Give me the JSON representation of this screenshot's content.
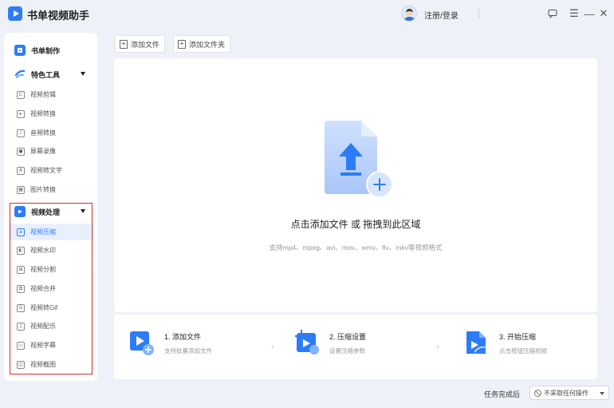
{
  "app": {
    "title": "书单视频助手",
    "login": "注册/登录"
  },
  "window": {
    "feedback_icon": "chat-icon",
    "menu": "☰",
    "minimize": "—",
    "close": "✕"
  },
  "sidebar": {
    "main1": {
      "label": "书单制作",
      "icon": "book-icon"
    },
    "main2": {
      "label": "特色工具",
      "icon": "wand-icon"
    },
    "tools": [
      {
        "label": "视频剪辑",
        "icon": "crop-icon",
        "glyph": "⊏"
      },
      {
        "label": "视频转换",
        "icon": "video-convert-icon",
        "glyph": "▸"
      },
      {
        "label": "音频转换",
        "icon": "audio-icon",
        "glyph": "♪"
      },
      {
        "label": "屏幕录像",
        "icon": "record-icon",
        "glyph": "●"
      },
      {
        "label": "视频转文字",
        "icon": "text-icon",
        "glyph": "A"
      },
      {
        "label": "图片转换",
        "icon": "image-icon",
        "glyph": "▦"
      }
    ],
    "main3": {
      "label": "视频处理",
      "icon": "video-process-icon"
    },
    "processing": [
      {
        "label": "视频压缩",
        "icon": "compress-icon",
        "glyph": "≡"
      },
      {
        "label": "视频水印",
        "icon": "watermark-icon",
        "glyph": "◐"
      },
      {
        "label": "视频分割",
        "icon": "split-icon",
        "glyph": "⊞"
      },
      {
        "label": "视频合并",
        "icon": "merge-icon",
        "glyph": "⧉"
      },
      {
        "label": "视频转Gif",
        "icon": "gif-icon",
        "glyph": "G"
      },
      {
        "label": "视频配乐",
        "icon": "music-icon",
        "glyph": "♫"
      },
      {
        "label": "视频字幕",
        "icon": "subtitle-icon",
        "glyph": "▭"
      },
      {
        "label": "视频截图",
        "icon": "screenshot-icon",
        "glyph": "◫"
      }
    ],
    "active": "视频压缩"
  },
  "toolbar": {
    "add_file": "添加文件",
    "add_folder": "添加文件夹"
  },
  "dropzone": {
    "title": "点击添加文件 或 拖拽到此区域",
    "hint": "支持mp4、mpeg、avi、mov、wmv、flv、mkv等视频格式"
  },
  "steps": [
    {
      "title": "1. 添加文件",
      "desc": "支持批量添加文件"
    },
    {
      "title": "2. 压缩设置",
      "desc": "设置压缩参数"
    },
    {
      "title": "3. 开始压缩",
      "desc": "点击按钮压缩视频"
    }
  ],
  "status": {
    "label": "任务完成后",
    "select": "不采取任何操作"
  },
  "colors": {
    "accent": "#2d7cf6",
    "highlight": "#d62e2e"
  }
}
